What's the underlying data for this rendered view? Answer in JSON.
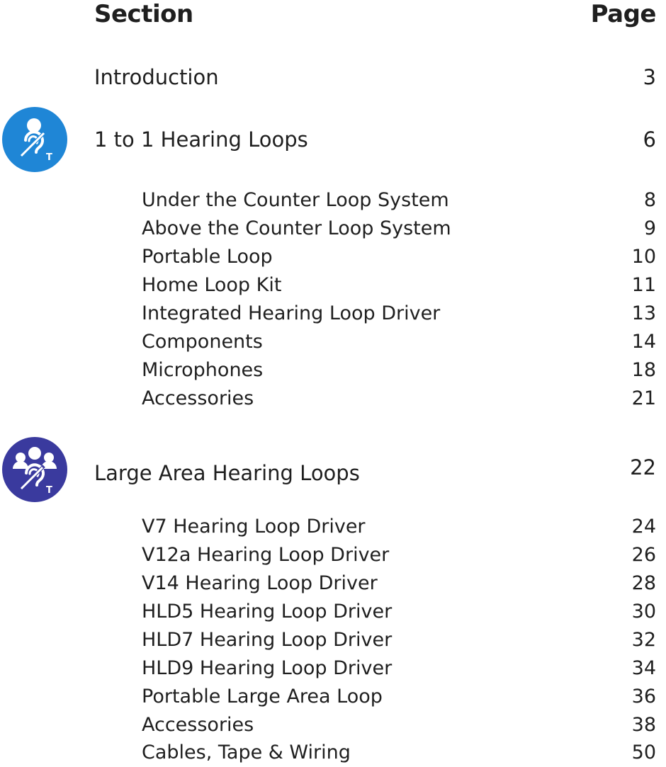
{
  "header": {
    "section_label": "Section",
    "page_label": "Page"
  },
  "rows": {
    "introduction": {
      "label": "Introduction",
      "page": "3"
    },
    "one_to_one": {
      "label": "1 to 1 Hearing Loops",
      "page": "6"
    },
    "under_counter": {
      "label": "Under the Counter Loop System",
      "page": "8"
    },
    "above_counter": {
      "label": "Above the Counter Loop System",
      "page": "9"
    },
    "portable_loop": {
      "label": "Portable Loop",
      "page": "10"
    },
    "home_loop": {
      "label": "Home Loop Kit",
      "page": "11"
    },
    "integrated_driver": {
      "label": "Integrated Hearing Loop Driver",
      "page": "13"
    },
    "components": {
      "label": "Components",
      "page": "14"
    },
    "microphones": {
      "label": "Microphones",
      "page": "18"
    },
    "accessories_1": {
      "label": "Accessories",
      "page": "21"
    },
    "large_area": {
      "label": "Large Area Hearing Loops",
      "page": "22"
    },
    "v7": {
      "label": "V7 Hearing Loop Driver",
      "page": "24"
    },
    "v12a": {
      "label": "V12a Hearing Loop Driver",
      "page": "26"
    },
    "v14": {
      "label": "V14 Hearing Loop Driver",
      "page": "28"
    },
    "hld5": {
      "label": "HLD5 Hearing Loop Driver",
      "page": "30"
    },
    "hld7": {
      "label": "HLD7 Hearing Loop Driver",
      "page": "32"
    },
    "hld9": {
      "label": "HLD9 Hearing Loop Driver",
      "page": "34"
    },
    "portable_large": {
      "label": "Portable Large Area Loop",
      "page": "36"
    },
    "accessories_2": {
      "label": "Accessories",
      "page": "38"
    },
    "cables": {
      "label": "Cables, Tape & Wiring",
      "page": "50"
    }
  },
  "icons": {
    "one_to_one": {
      "name": "hearing-loop-single-person-icon",
      "color": "#1f86d6",
      "letter": "T"
    },
    "large_area": {
      "name": "hearing-loop-group-icon",
      "color": "#3a3a9e",
      "letter": "T"
    }
  }
}
